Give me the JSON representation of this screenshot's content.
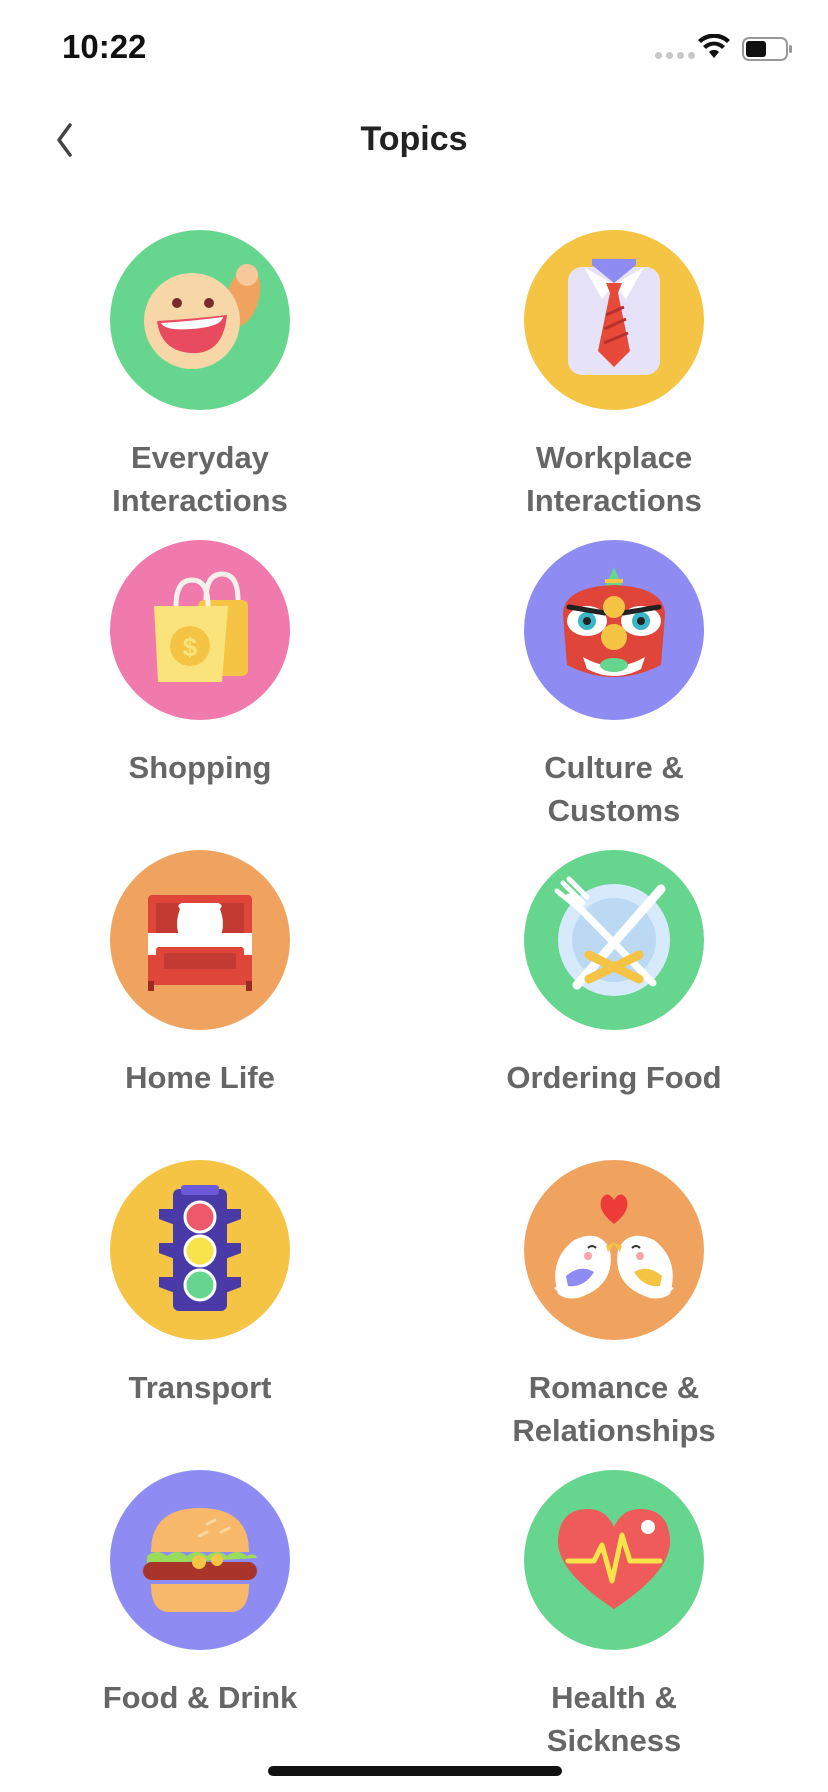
{
  "status_bar": {
    "time": "10:22"
  },
  "header": {
    "title": "Topics"
  },
  "topics": [
    {
      "label": "Everyday\nInteractions",
      "icon": "waving-face-icon",
      "color": "#66d68e"
    },
    {
      "label": "Workplace\nInteractions",
      "icon": "shirt-tie-icon",
      "color": "#f5c444"
    },
    {
      "label": "Shopping",
      "icon": "shopping-bag-icon",
      "color": "#ef7aab"
    },
    {
      "label": "Culture &\nCustoms",
      "icon": "lion-dance-icon",
      "color": "#8e8bf3"
    },
    {
      "label": "Home Life",
      "icon": "bed-icon",
      "color": "#f0a35f"
    },
    {
      "label": "Ordering Food",
      "icon": "plate-cutlery-icon",
      "color": "#66d68e"
    },
    {
      "label": "Transport",
      "icon": "traffic-light-icon",
      "color": "#f5c444"
    },
    {
      "label": "Romance &\nRelationships",
      "icon": "love-birds-icon",
      "color": "#f0a35f"
    },
    {
      "label": "Food & Drink",
      "icon": "burger-icon",
      "color": "#8e8bf3"
    },
    {
      "label": "Health &\nSickness",
      "icon": "heartbeat-icon",
      "color": "#66d68e"
    }
  ]
}
